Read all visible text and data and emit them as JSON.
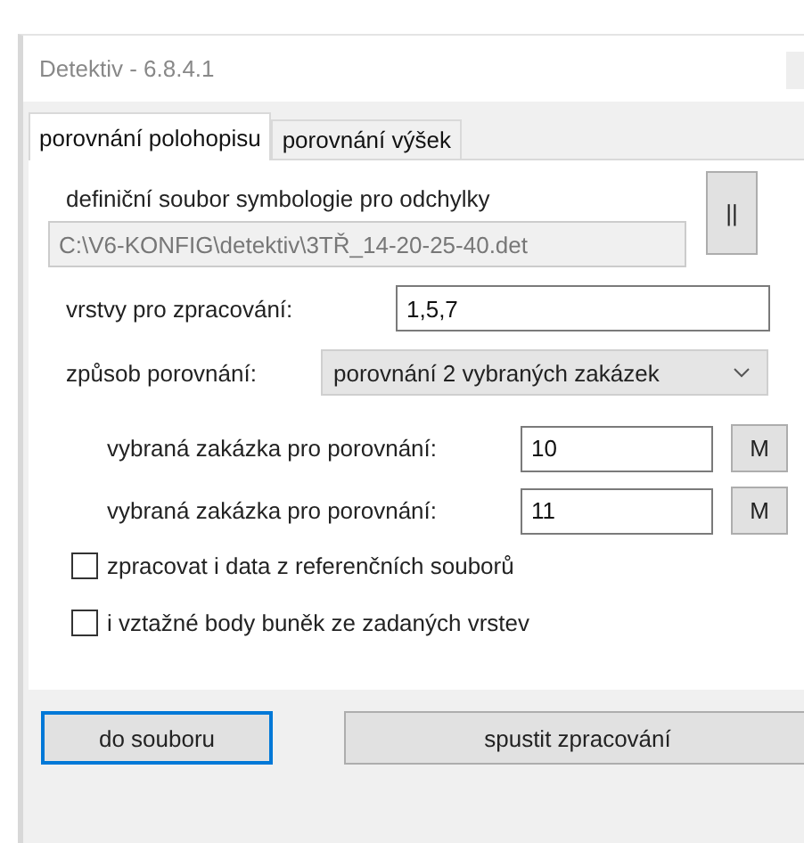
{
  "window": {
    "title": "Detektiv - 6.8.4.1"
  },
  "tabs": [
    {
      "label": "porovnání polohopisu",
      "selected": true
    },
    {
      "label": "porovnání výšek",
      "selected": false
    }
  ],
  "symbology": {
    "label": "definiční soubor symbologie pro odchylky",
    "value": "C:\\V6-KONFIG\\detektiv\\3TŘ_14-20-25-40.det",
    "disabled": true,
    "browse_button": "||"
  },
  "layers": {
    "label": "vrstvy pro zpracování:",
    "value": "1,5,7"
  },
  "comparison": {
    "label": "způsob porovnání:",
    "value": "porovnání 2 vybraných zakázek"
  },
  "orders": [
    {
      "label": "vybraná zakázka pro porovnání:",
      "value": "10",
      "button": "M"
    },
    {
      "label": "vybraná zakázka pro porovnání:",
      "value": "11",
      "button": "M"
    }
  ],
  "checkboxes": [
    {
      "label": "zpracovat i data z referenčních souborů",
      "checked": false
    },
    {
      "label": "i vztažné body buněk ze zadaných vrstev",
      "checked": false
    }
  ],
  "buttons": [
    {
      "label": "do souboru",
      "focused": true
    },
    {
      "label": "spustit zpracování",
      "focused": false
    }
  ]
}
